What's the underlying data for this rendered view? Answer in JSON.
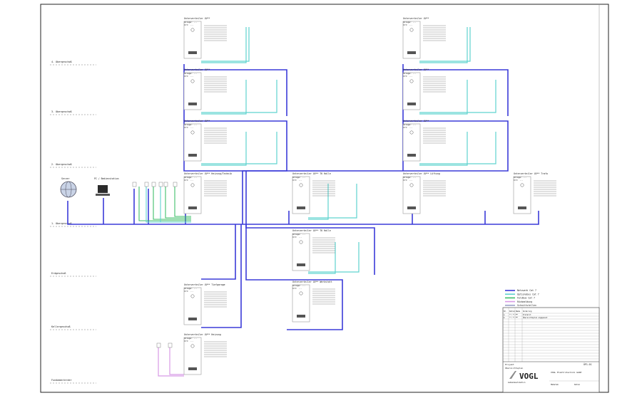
{
  "colors": {
    "frame": "#222222",
    "bus_blue": "#3b3bd9",
    "cyan": "#5fd3cf",
    "green": "#3fbf6a",
    "pink": "#d89ae6",
    "grey_line": "#9aa0c8",
    "logo_red": "#cc1f2a"
  },
  "floors": [
    "4. Obergeschoß",
    "3. Obergeschoß",
    "2. Obergeschoß",
    "1. Obergeschoß",
    "Erdgeschoß",
    "Kellergeschoß",
    "Fundamenterder"
  ],
  "cabinets": [
    {
      "title": "Unterverteiler UV**",
      "sub": [
        "Anlage: ...",
        "Ort: ..."
      ]
    },
    {
      "title": "Unterverteiler UV**",
      "sub": [
        "Anlage: ...",
        "Ort: ..."
      ]
    },
    {
      "title": "Unterverteiler UV**",
      "sub": [
        "Anlage: ...",
        "Ort: ..."
      ]
    },
    {
      "title": "Unterverteiler UV**",
      "sub": [
        "Anlage: ...",
        "Ort: ..."
      ]
    },
    {
      "title": "Unterverteiler UV**",
      "sub": [
        "Anlage: ...",
        "Ort: ..."
      ]
    },
    {
      "title": "Unterverteiler UV**",
      "sub": [
        "Anlage: ...",
        "Ort: ..."
      ]
    },
    {
      "title": "Unterverteiler UV** Heizung/Technik",
      "sub": [
        "Anlage: ...",
        "Ort: ..."
      ]
    },
    {
      "title": "Unterverteiler UV** TK Halle",
      "sub": [
        "Anlage: ...",
        "Ort: ..."
      ]
    },
    {
      "title": "Unterverteiler UV** Lüftung",
      "sub": [
        "Anlage: ...",
        "Ort: ..."
      ]
    },
    {
      "title": "Unterverteiler UV** Trafo",
      "sub": [
        "Anlage: ...",
        "Ort: ..."
      ]
    },
    {
      "title": "Unterverteiler UV** TK Halle",
      "sub": [
        "Anlage: ...",
        "Ort: ..."
      ]
    },
    {
      "title": "Unterverteiler UV** Tiefgarage",
      "sub": [
        "Anlage: ...",
        "Ort: ..."
      ]
    },
    {
      "title": "Unterverteiler UV** Werkstatt",
      "sub": [
        "Anlage: ...",
        "Ort: ..."
      ]
    },
    {
      "title": "Unterverteiler UV** Heizung",
      "sub": [
        "Anlage: ...",
        "Ort: ..."
      ]
    }
  ],
  "server": {
    "label": "Server"
  },
  "pc": {
    "label": "PC / Bedienstation"
  },
  "legend": [
    {
      "label": "Netzwerk Cat 7",
      "color": "#3b3bd9"
    },
    {
      "label": "Optionsbus Cat 7",
      "color": "#5fd3cf"
    },
    {
      "label": "Feldbus Cat 7",
      "color": "#3fbf6a"
    },
    {
      "label": "Rückmeldung",
      "color": "#d89ae6"
    },
    {
      "label": "Schnittstellen",
      "color": "#9aa0c8"
    }
  ],
  "title_block": {
    "revision_header": [
      "Nr.",
      "Datum",
      "Name",
      "Änderung"
    ],
    "revisions": [
      [
        "a",
        "**.**.**",
        "**",
        "Erstellt"
      ],
      [
        "b",
        "**.**.**",
        "**",
        "Übersichtsplan angepasst"
      ]
    ],
    "project_label": "Projekt",
    "project_value": "Übersichtsplan",
    "drawing_no": "ÜP1-01",
    "company": "VOGL Elektrotechnik GmbH",
    "company_sub": "Gebäudeautomation",
    "logo_text": "VOGL",
    "scale_label": "Maßstab",
    "date_label": "Datum"
  }
}
